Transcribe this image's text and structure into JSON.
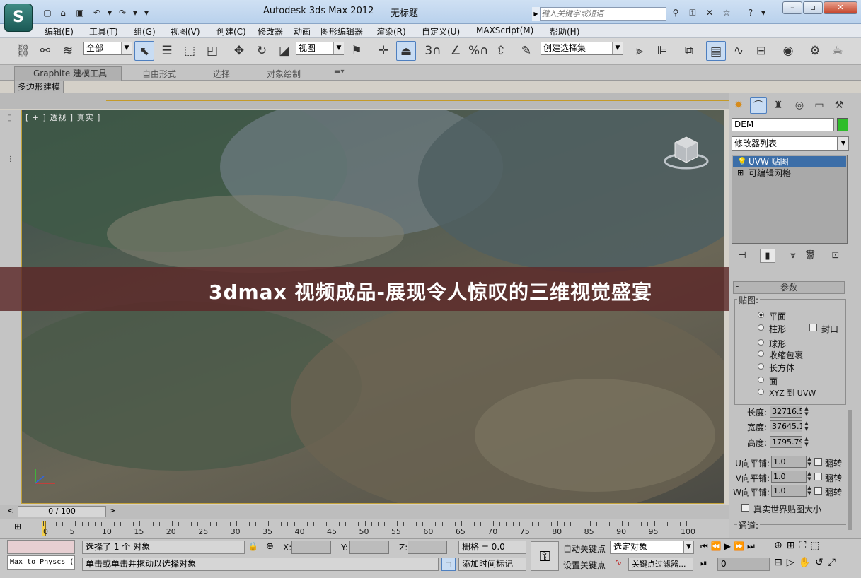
{
  "app": {
    "title": "Autodesk 3ds Max  2012",
    "document": "无标题",
    "logo": "3ds Max logo",
    "search_placeholder": "键入关键字或短语"
  },
  "menubar": {
    "items": [
      "编辑(E)",
      "工具(T)",
      "组(G)",
      "视图(V)",
      "创建(C)",
      "修改器",
      "动画",
      "图形编辑器",
      "渲染(R)",
      "自定义(U)",
      "MAXScript(M)",
      "帮助(H)"
    ]
  },
  "toolbar": {
    "selection_filter": "全部",
    "ref_coord": "视图",
    "named_selection": "创建选择集",
    "snap_3": "3",
    "percent_snap": "%"
  },
  "ribbon": {
    "tabs": [
      "Graphite 建模工具",
      "自由形式",
      "选择",
      "对象绘制"
    ],
    "active_panel": "多边形建模"
  },
  "viewport": {
    "label": "[ + ] 透视 ] 真实 ]"
  },
  "timeline": {
    "slider": "0 / 100",
    "ticks": [
      "0",
      "5",
      "10",
      "15",
      "20",
      "25",
      "30",
      "35",
      "40",
      "45",
      "50",
      "55",
      "60",
      "65",
      "70",
      "75",
      "80",
      "85",
      "90",
      "95",
      "100"
    ]
  },
  "status": {
    "maxscript_listener": "Max to Physcs (",
    "selection_info": "选择了 1 个 对象",
    "prompt": "单击或单击并拖动以选择对象",
    "x_label": "X:",
    "y_label": "Y:",
    "z_label": "Z:",
    "grid": "栅格 = 0.0",
    "add_time_tag": "添加时间标记",
    "auto_key": "自动关键点",
    "set_key": "设置关键点",
    "selected_object": "选定对象",
    "key_filters": "关键点过滤器...",
    "frame": "0"
  },
  "command_panel": {
    "object_name": "DEM__",
    "object_color": "#2fbd2a",
    "modifier_list": "修改器列表",
    "stack": [
      "UVW 贴图",
      "可编辑网格"
    ],
    "rollout": "参数",
    "rollout_minus": "-",
    "mapping_group": "贴图:",
    "mapping_options": [
      "平面",
      "柱形",
      "球形",
      "收缩包裹",
      "长方体",
      "面",
      "XYZ 到 UVW"
    ],
    "cap_label": "封口",
    "length_label": "长度:",
    "length_value": "32716.5",
    "width_label": "宽度:",
    "width_value": "37645.1",
    "height_label": "高度:",
    "height_value": "1795.79",
    "u_tile_label": "U向平铺:",
    "u_tile": "1.0",
    "v_tile_label": "V向平铺:",
    "v_tile": "1.0",
    "w_tile_label": "W向平铺:",
    "w_tile": "1.0",
    "flip_label": "翻转",
    "real_world": "真实世界贴图大小",
    "channel_group": "通道:"
  },
  "banner": {
    "text": "3dmax 视频成品-展现令人惊叹的三维视觉盛宴"
  }
}
